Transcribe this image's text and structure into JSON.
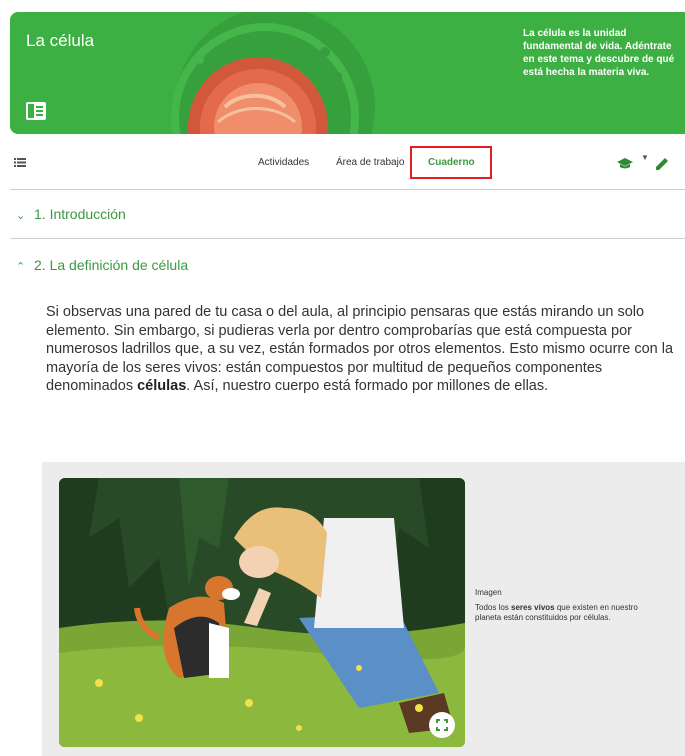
{
  "header": {
    "title": "La célula",
    "description": "La célula es la unidad fundamental de vida. Adéntrate en este tema y descubre de qué está hecha la materia viva.",
    "color": "#3db043"
  },
  "toolbar": {
    "tabs": [
      {
        "label": "Actividades"
      },
      {
        "label": "Área de trabajo"
      },
      {
        "label": "Cuaderno"
      }
    ],
    "active_tab": "Cuaderno"
  },
  "sections": [
    {
      "label": "1. Introducción",
      "expanded": false
    },
    {
      "label": "2. La definición de célula",
      "expanded": true
    }
  ],
  "content": {
    "para_1": "Si observas una pared de tu casa o del aula, al principio pensaras que estás mirando un solo elemento. Sin embargo, si pudieras verla por dentro comprobarías que está compuesta por numerosos ladrillos que, a su vez, están formados por otros elementos. Esto mismo ocurre con la mayoría de los seres vivos: están compuestos por multitud de pequeños componentes denominados ",
    "bold": "células",
    "para_2": ". Así, nuestro cuerpo está formado por millones de ellas."
  },
  "media": {
    "label": "Imagen",
    "caption_1": "Todos los ",
    "caption_bold": "seres vivos",
    "caption_2": " que existen en nuestro planeta están constituidos por células."
  },
  "icons": {
    "list": "list-icon",
    "book": "book-icon",
    "cap": "graduation-cap-icon",
    "pencil": "pencil-icon",
    "expand": "expand-icon"
  },
  "colors": {
    "accent": "#3a9a3f",
    "highlight_box": "#e02020",
    "card_bg": "#ececec"
  }
}
